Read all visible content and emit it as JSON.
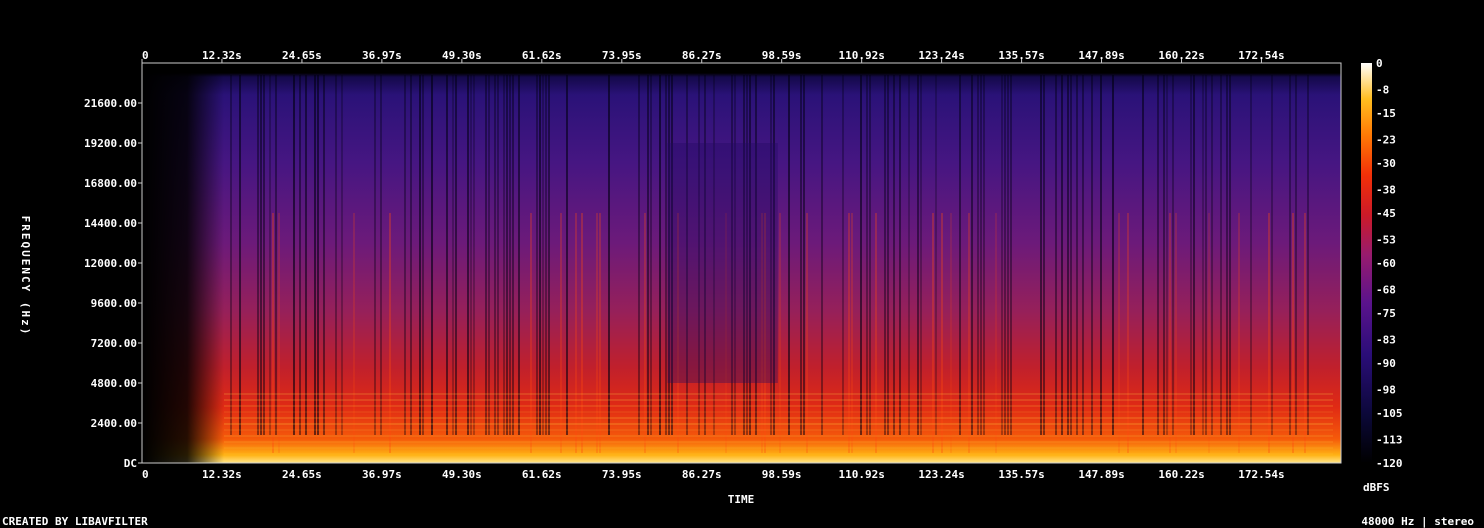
{
  "chart_data": {
    "type": "heatmap",
    "title": "",
    "xlabel": "TIME",
    "ylabel": "FREQUENCY (Hz)",
    "x_ticks": [
      "0",
      "12.32s",
      "24.65s",
      "36.97s",
      "49.30s",
      "61.62s",
      "73.95s",
      "86.27s",
      "98.59s",
      "110.92s",
      "123.24s",
      "135.57s",
      "147.89s",
      "160.22s",
      "172.54s"
    ],
    "x_tick_seconds": [
      0,
      12.32,
      24.65,
      36.97,
      49.3,
      61.62,
      73.95,
      86.27,
      98.59,
      110.92,
      123.24,
      135.57,
      147.89,
      160.22,
      172.54
    ],
    "xlim": [
      0,
      184.8
    ],
    "y_ticks": [
      "DC",
      "2400.00",
      "4800.00",
      "7200.00",
      "9600.00",
      "12000.00",
      "14400.00",
      "16800.00",
      "19200.00",
      "21600.00"
    ],
    "y_tick_hz": [
      0,
      2400,
      4800,
      7200,
      9600,
      12000,
      14400,
      16800,
      19200,
      21600
    ],
    "ylim": [
      0,
      24000
    ],
    "colorbar": {
      "label": "dBFS",
      "ticks": [
        "0",
        "-8",
        "-15",
        "-23",
        "-30",
        "-38",
        "-45",
        "-53",
        "-60",
        "-68",
        "-75",
        "-83",
        "-90",
        "-98",
        "-105",
        "-113",
        "-120"
      ],
      "range": [
        -120,
        0
      ]
    },
    "footer_left": "CREATED BY LIBAVFILTER",
    "footer_right": "48000 Hz | stereo"
  }
}
